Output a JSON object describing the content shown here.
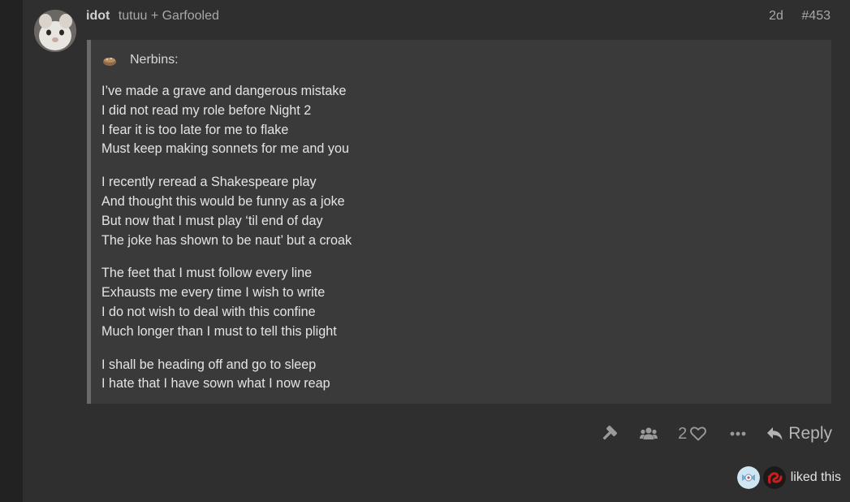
{
  "post": {
    "author": "idot",
    "subtitle": "tutuu + Garfooled",
    "age": "2d",
    "number": "#453"
  },
  "quote": {
    "author_label": "Nerbins:",
    "stanzas": [
      [
        "I’ve made a grave and dangerous mistake",
        "I did not read my role before Night 2",
        "I fear it is too late for me to flake",
        "Must keep making sonnets for me and you"
      ],
      [
        "I recently reread a Shakespeare play",
        "And thought this would be funny as a joke",
        "But now that I must play ‘til end of day",
        "The joke has shown to be naut’ but a croak"
      ],
      [
        "The feet that I must follow every line",
        "Exhausts me every time I wish to write",
        "I do not wish to deal with this confine",
        "Much longer than I must to tell this plight"
      ],
      [
        "I shall be heading off and go to sleep",
        "I hate that I have sown what I now reap"
      ]
    ]
  },
  "actions": {
    "like_count": "2",
    "reply_label": "Reply",
    "icons": [
      "hammer-icon",
      "users-icon",
      "heart-icon",
      "more-icon",
      "reply-icon"
    ]
  },
  "likes": {
    "label": "liked this"
  },
  "colors": {
    "background": "#222222",
    "panel": "#2f2f2f",
    "quote_bg": "#3a3a3a",
    "liker_red": "#c81e1e"
  }
}
